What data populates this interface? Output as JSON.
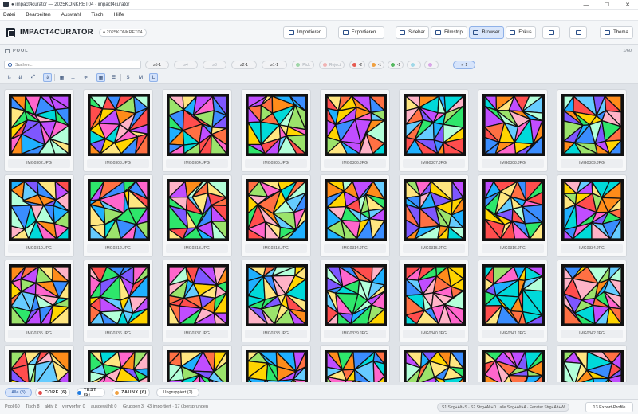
{
  "window": {
    "title": "● impact4curator — 2025KONKRET04 · impact4curator"
  },
  "menu": [
    "Datei",
    "Bearbeiten",
    "Auswahl",
    "Tisch",
    "Hilfe"
  ],
  "header": {
    "brand": "IMPACT4CURATOR",
    "project": "● 2025KONKRET04",
    "import_label": "Importieren",
    "export_label": "Exportieren...",
    "sidebar_label": "Sidebar",
    "filmstrip_label": "Filmstrip",
    "browser_label": "Browser",
    "fokus_label": "Fokus",
    "theme_label": "Thema"
  },
  "pool": {
    "label": "POOL",
    "count": "1/60"
  },
  "search": {
    "placeholder": "Suchen..."
  },
  "filters": [
    {
      "label": "≥5·1",
      "dim": false
    },
    {
      "label": "≥4",
      "dim": true
    },
    {
      "label": "≥3",
      "dim": true
    },
    {
      "label": "≥2·1",
      "dim": false
    },
    {
      "label": "≥1·1",
      "dim": false
    },
    {
      "label": "Pick",
      "dim": true,
      "dot": "#9fd6a8"
    },
    {
      "label": "Reject",
      "dim": true,
      "dot": "#f1b3b3"
    },
    {
      "label": "-2",
      "dim": false,
      "dot": "#e65a50"
    },
    {
      "label": "-1",
      "dim": false,
      "dot": "#f0a040"
    },
    {
      "label": "-1",
      "dim": false,
      "dot": "#55b860"
    },
    {
      "label": "",
      "dim": true,
      "dot": "#9fd8e8"
    },
    {
      "label": "",
      "dim": true,
      "dot": "#d9a5e8"
    },
    {
      "label": "✓ 1",
      "dim": false,
      "sel": true
    }
  ],
  "view": {
    "size_s": "S",
    "size_m": "M",
    "size_l": "L"
  },
  "images": [
    "IMG0302.JPG",
    "IMG0303.JPG",
    "IMG0304.JPG",
    "IMG0305.JPG",
    "IMG0306.JPG",
    "IMG0307.JPG",
    "IMG0308.JPG",
    "IMG0309.JPG",
    "IMG0310.JPG",
    "IMG0312.JPG",
    "IMG0313.JPG",
    "IMG0313.JPG",
    "IMG0314.JPG",
    "IMG0315.JPG",
    "IMG0316.JPG",
    "IMG0334.JPG",
    "IMG0335.JPG",
    "IMG0336.JPG",
    "IMG0337.JPG",
    "IMG0338.JPG",
    "IMG0339.JPG",
    "IMG0340.JPG",
    "IMG0341.JPG",
    "IMG0342.JPG",
    "",
    "",
    "",
    "",
    "",
    "",
    "",
    ""
  ],
  "palette": [
    "#ff4d4d",
    "#ffd400",
    "#3a8dff",
    "#2ee66b",
    "#ff8c1a",
    "#c04dff",
    "#00d9d9",
    "#ff66cc",
    "#9be36b",
    "#ff7043",
    "#7e57ff",
    "#1fb0ff",
    "#ffb3c7",
    "#b3ffd9",
    "#ffe680",
    "#66ccff"
  ],
  "groups": [
    {
      "label": "Alle (8)",
      "active": true
    },
    {
      "label": "CORE (6)",
      "dot": "#e24a4a",
      "bold": true
    },
    {
      "label": "TEST (5)",
      "dot": "#1f7be0",
      "bold": true
    },
    {
      "label": "ZAUNX (6)",
      "dot": "#f0a040",
      "bold": true
    },
    {
      "label": "Ungruppiert (2)"
    }
  ],
  "status": {
    "pool": "Pool 60",
    "tisch": "Tisch 8",
    "aktiv": "aktiv 8",
    "verworfen": "verworfen 0",
    "ausgewaehlt": "ausgewählt 0",
    "gruppen": "Gruppen 3",
    "importiert": "43 importiert · 17 übersprungen",
    "shortcuts": "S1 Strg+Alt+S · S2 Strg+Alt+D · alle Strg+Alt+A · Fenster Strg+Alt+W",
    "export_profiles": "13 Export-Profile"
  }
}
